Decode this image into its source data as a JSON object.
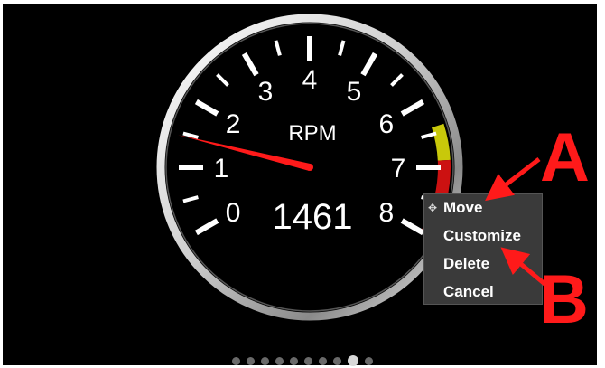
{
  "gauge": {
    "label": "RPM",
    "value_text": "1461",
    "value": 1461,
    "max_rpm": 8,
    "ticks": [
      "0",
      "1",
      "2",
      "3",
      "4",
      "5",
      "6",
      "7",
      "8"
    ],
    "colors": {
      "needle": "#ff1a1a",
      "redline": "#cc1111",
      "caution": "#c8c80a",
      "ticks": "#ffffff",
      "bezel": "#d9d9d9",
      "face": "#000000"
    }
  },
  "context_menu": {
    "items": [
      {
        "label": "Move",
        "icon": "move-arrows-icon"
      },
      {
        "label": "Customize"
      },
      {
        "label": "Delete"
      },
      {
        "label": "Cancel"
      }
    ]
  },
  "pager": {
    "count": 10,
    "active_index": 8
  },
  "annotations": {
    "label_a": "A",
    "label_b": "B",
    "color": "#ff1a1a"
  }
}
